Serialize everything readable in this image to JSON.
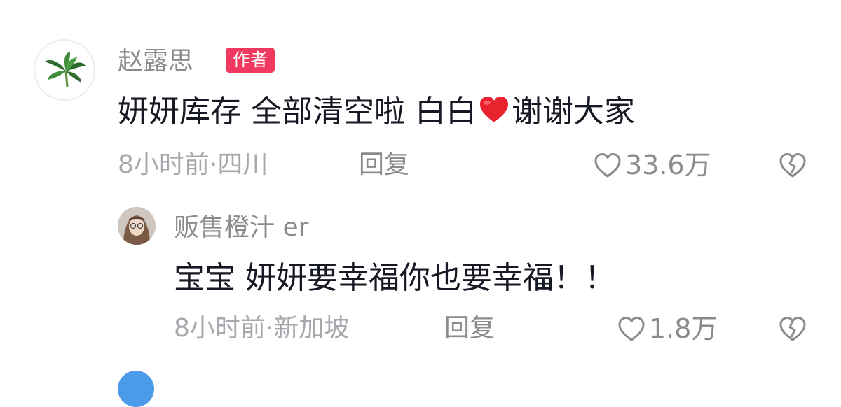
{
  "comments": [
    {
      "avatar": "green-leaf-avatar",
      "username": "赵露思",
      "badge": "作者",
      "text_before": "妍妍库存 全部清空啦 白白",
      "text_after": "谢谢大家",
      "emoji": "red-heart",
      "meta": "8小时前·四川",
      "reply_label": "回复",
      "like_count": "33.6万"
    },
    {
      "avatar": "woman-photo-avatar",
      "username": "贩售橙汁 er",
      "text": "宝宝 妍妍要幸福你也要幸福！！",
      "meta": "8小时前·新加坡",
      "reply_label": "回复",
      "like_count": "1.8万"
    }
  ],
  "colors": {
    "badge_bg": "#f1395f",
    "text": "#161823",
    "secondary": "#8a8a8f",
    "meta": "#a7a7ad"
  }
}
